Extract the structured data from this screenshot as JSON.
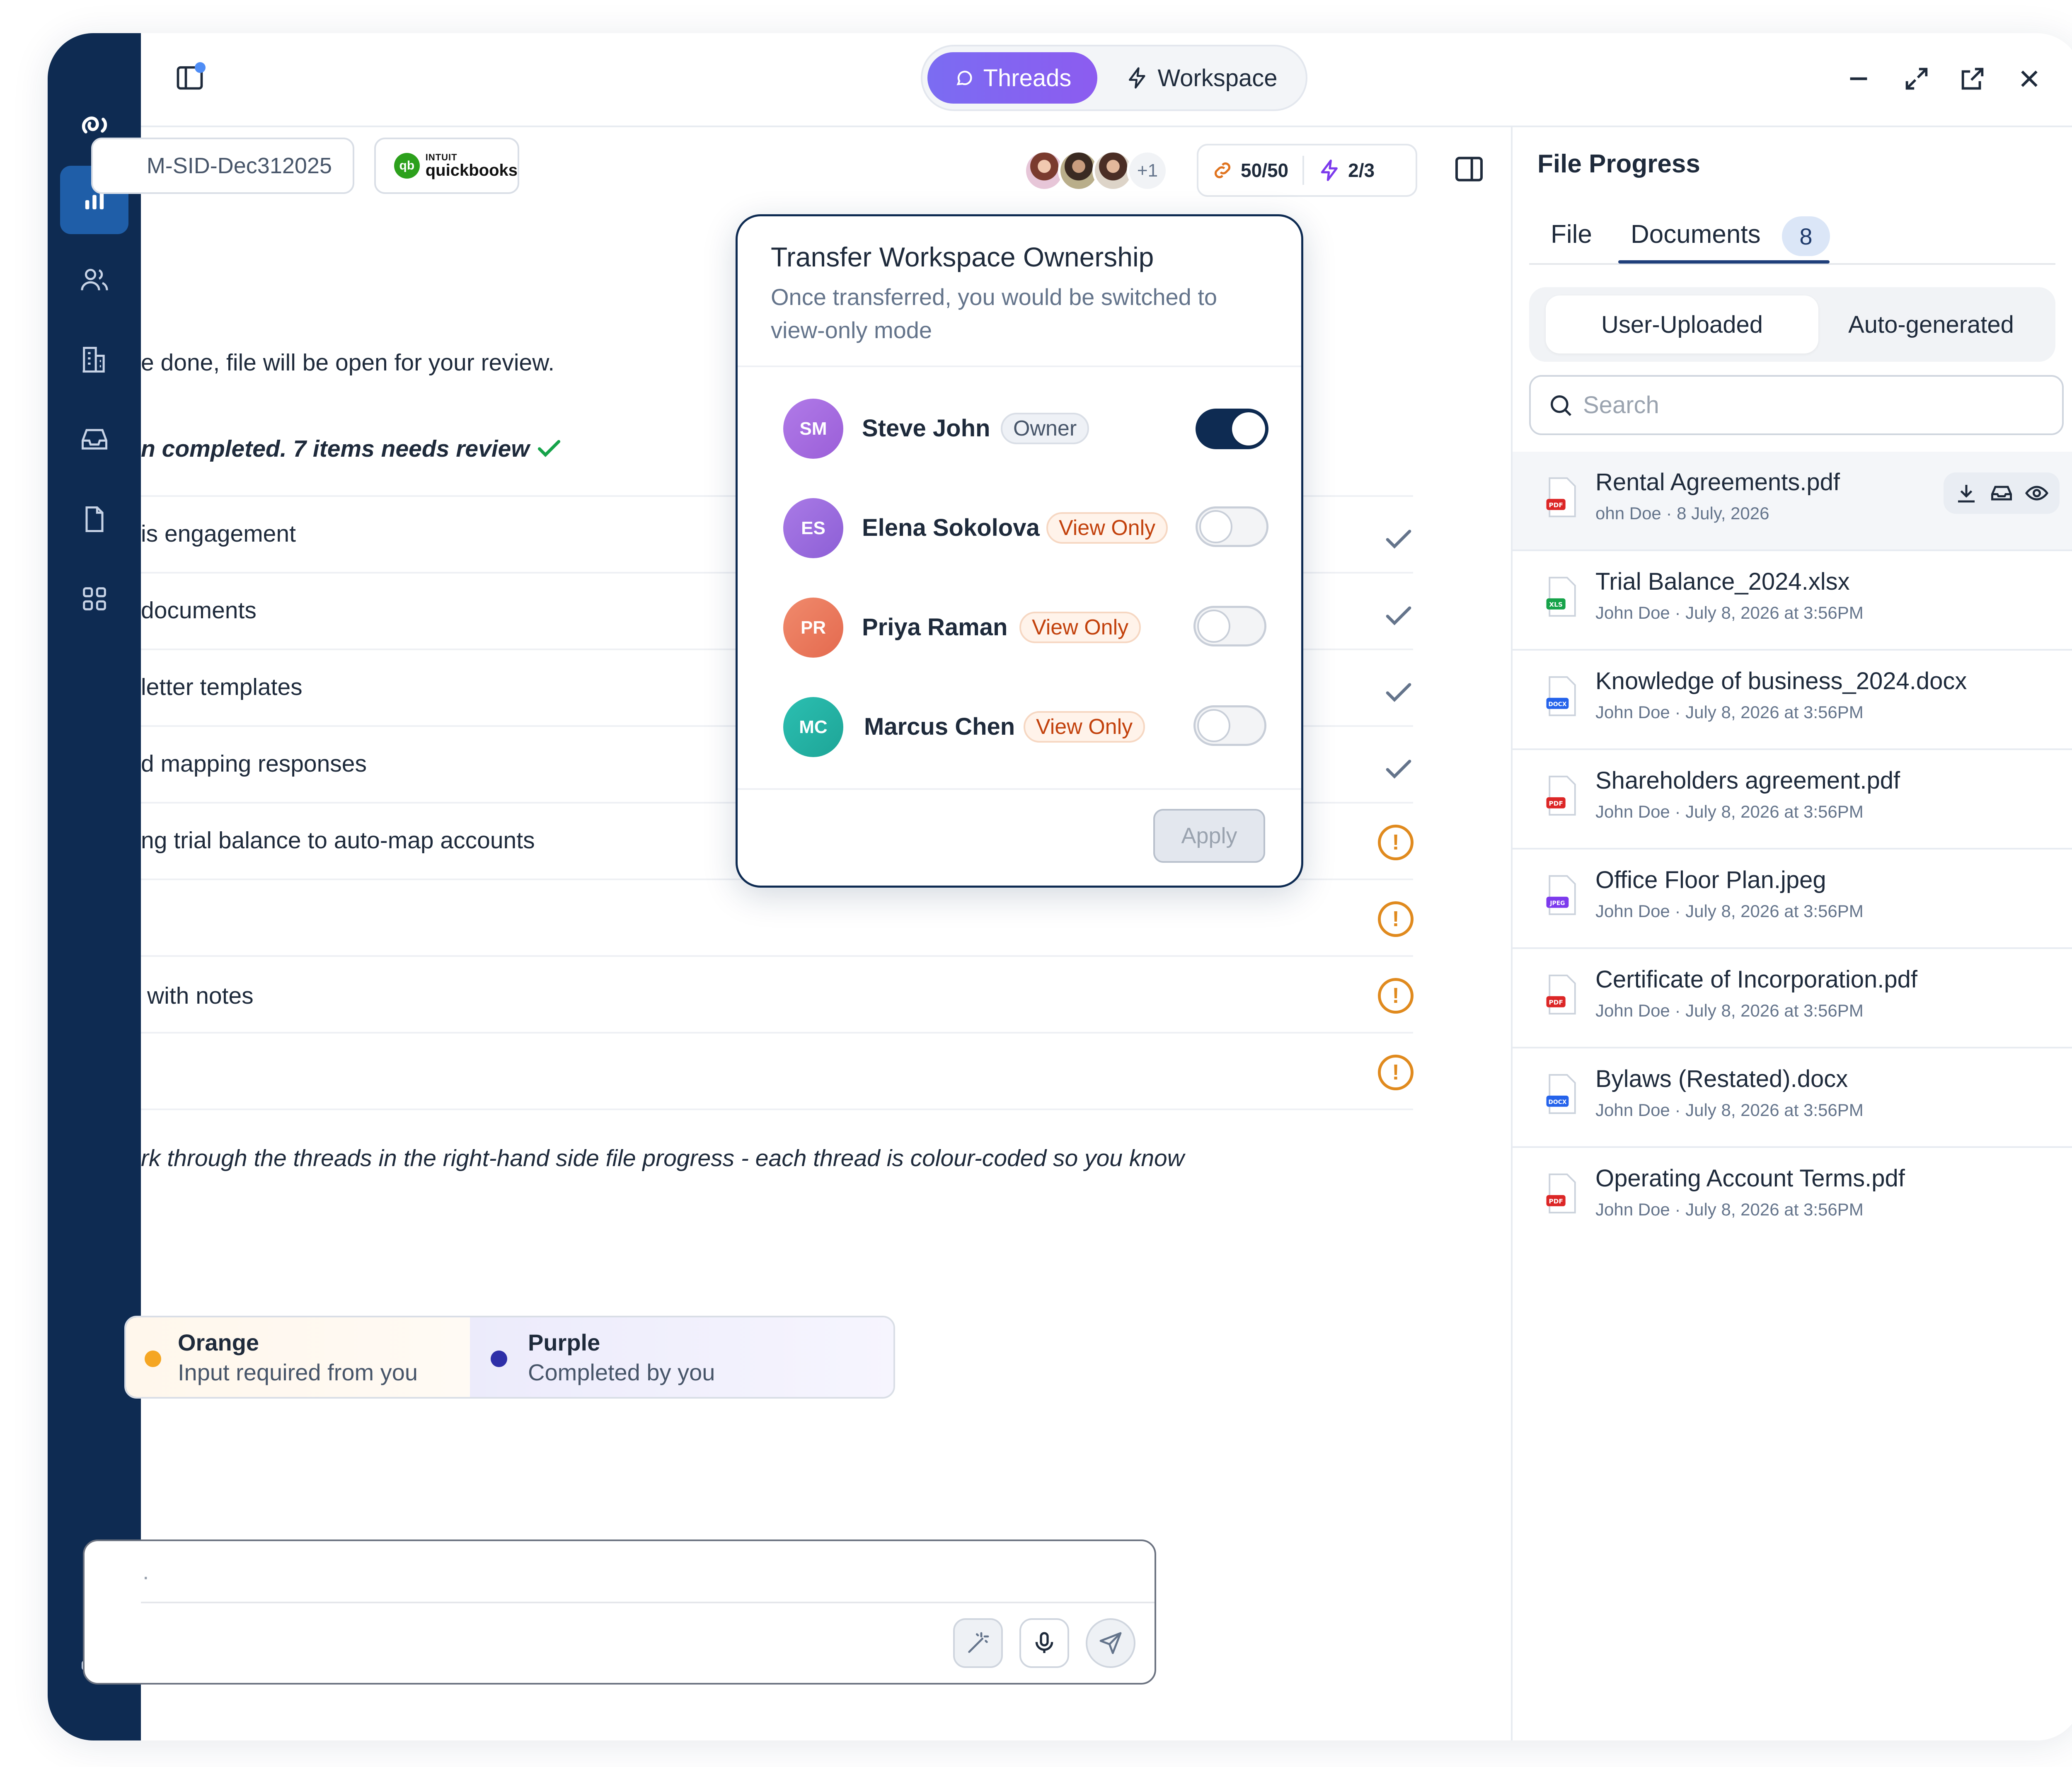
{
  "top": {
    "tabs": {
      "threads": "Threads",
      "workspace": "Workspace"
    }
  },
  "header": {
    "file_code": "M-SID-Dec312025",
    "integration": {
      "intuit": "INTUIT",
      "name": "quickbooks"
    },
    "participants_more": "+1",
    "counter_links": "50/50",
    "counter_bolt": "2/3"
  },
  "chat": {
    "line_intro": "e done, file will be open for your review.",
    "line_status": "n completed. 7 items needs review",
    "tasks": [
      {
        "label": "is engagement",
        "status": "done"
      },
      {
        "label": "documents",
        "status": "done"
      },
      {
        "label": "letter templates",
        "status": "done"
      },
      {
        "label": "d mapping responses",
        "status": "done"
      },
      {
        "label": "ng trial balance to auto-map accounts",
        "status": "review"
      },
      {
        "label": "",
        "status": "review"
      },
      {
        "label": "with notes",
        "status": "review"
      },
      {
        "label": "",
        "status": "review"
      }
    ],
    "line_threads": "rk through the threads in the right-hand side file progress - each thread is colour-coded so you know",
    "legend": [
      {
        "title": "Orange",
        "subtitle": "Input required from you",
        "color": "#f5a623"
      },
      {
        "title": "Purple",
        "subtitle": "Completed by you",
        "color": "#2e2fa8"
      }
    ],
    "composer_placeholder": "."
  },
  "modal": {
    "title": "Transfer Workspace Ownership",
    "subtitle": "Once transferred, you would be switched to view-only mode",
    "members": [
      {
        "initials": "SM",
        "name": "Steve John",
        "role": "Owner",
        "owner": true,
        "color": "#a66ee0"
      },
      {
        "initials": "ES",
        "name": "Elena Sokolova",
        "role": "View Only",
        "owner": false,
        "color": "#a06be0"
      },
      {
        "initials": "PR",
        "name": "Priya Raman",
        "role": "View Only",
        "owner": false,
        "color": "#ee7a5e"
      },
      {
        "initials": "MC",
        "name": "Marcus Chen",
        "role": "View Only",
        "owner": false,
        "color": "#26b3a6"
      }
    ],
    "apply_label": "Apply"
  },
  "panel": {
    "title": "File Progress",
    "tab_file": "File",
    "tab_documents": "Documents",
    "documents_count": "8",
    "seg_user": "User-Uploaded",
    "seg_auto": "Auto-generated",
    "search_placeholder": "Search",
    "files": [
      {
        "name": "Rental Agreements.pdf",
        "meta": "ohn Doe · 8 July, 2026",
        "type": "PDF"
      },
      {
        "name": "Trial Balance_2024.xlsx",
        "meta": "John Doe · July 8, 2026 at 3:56PM",
        "type": "XLS"
      },
      {
        "name": "Knowledge of business_2024.docx",
        "meta": "John Doe · July 8, 2026 at 3:56PM",
        "type": "DOCX"
      },
      {
        "name": "Shareholders agreement.pdf",
        "meta": "John Doe · July 8, 2026 at 3:56PM",
        "type": "PDF"
      },
      {
        "name": "Office Floor Plan.jpeg",
        "meta": "John Doe · July 8, 2026 at 3:56PM",
        "type": "JPEG"
      },
      {
        "name": "Certificate of Incorporation.pdf",
        "meta": "John Doe · July 8, 2026 at 3:56PM",
        "type": "PDF"
      },
      {
        "name": "Bylaws (Restated).docx",
        "meta": "John Doe · July 8, 2026 at 3:56PM",
        "type": "DOCX"
      },
      {
        "name": "Operating Account Terms.pdf",
        "meta": "John Doe · July 8, 2026 at 3:56PM",
        "type": "PDF"
      }
    ]
  }
}
